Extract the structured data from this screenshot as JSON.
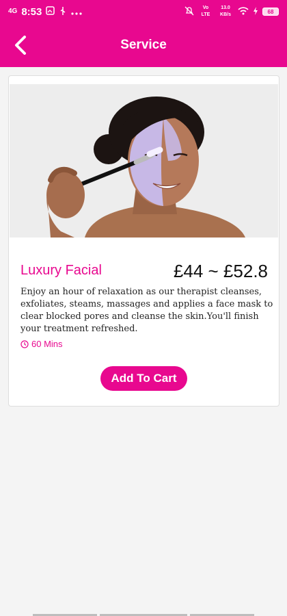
{
  "status_bar": {
    "time": "8:53",
    "carrier_small": "4G",
    "net_small": "Vo LTE",
    "speed_small": "13.0 KB/s",
    "battery": "68",
    "icons": [
      "sim-icon",
      "photo-icon",
      "usb-icon",
      "more-dots-icon",
      "mute-icon",
      "wifi-icon",
      "charging-icon",
      "battery-icon"
    ]
  },
  "appbar": {
    "title": "Service",
    "back_icon": "chevron-left-icon",
    "color": "#e8088f"
  },
  "service": {
    "name": "Luxury Facial",
    "price": "£44 ~ £52.8",
    "description": "Enjoy an hour of relaxation as our therapist cleanses, exfoliates, steams, massages and applies a face mask to clear blocked pores and cleanse the skin.You'll finish your treatment refreshed.",
    "duration": "60 Mins",
    "duration_icon": "clock-icon",
    "cta": "Add To Cart"
  }
}
